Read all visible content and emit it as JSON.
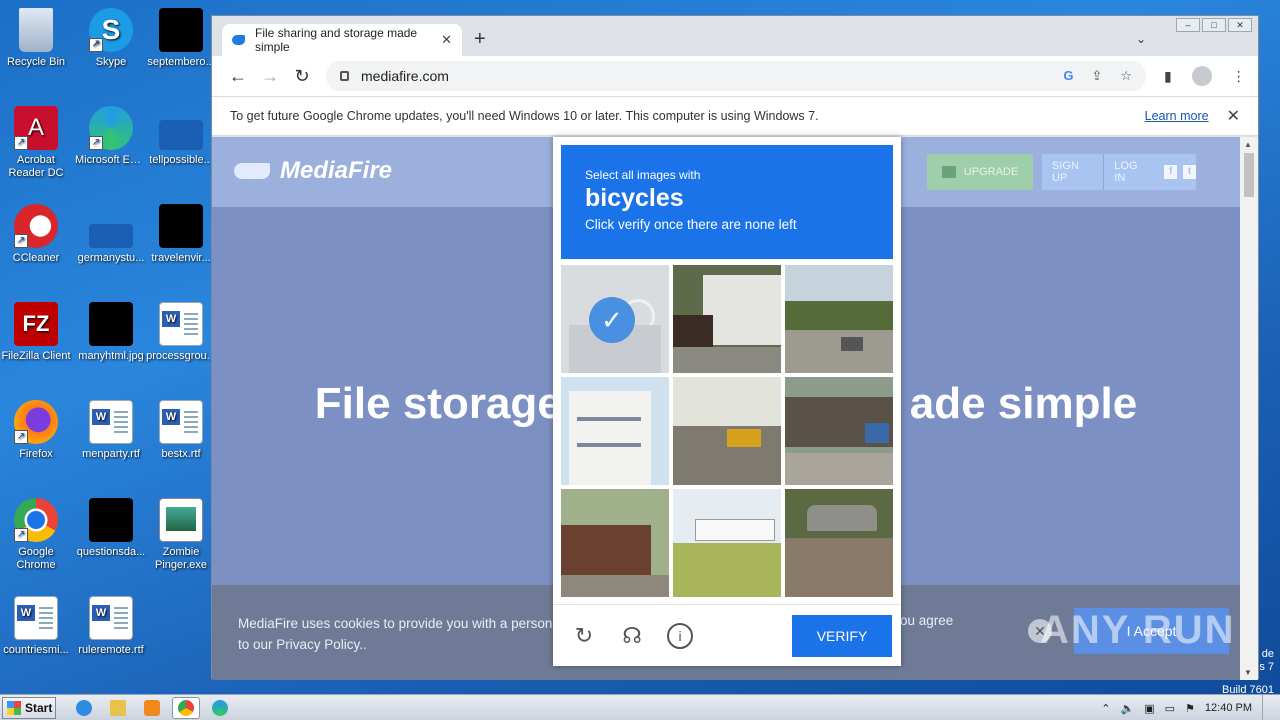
{
  "desktop": {
    "icons": [
      {
        "label": "Recycle Bin"
      },
      {
        "label": "Skype"
      },
      {
        "label": "septembero..."
      },
      {
        "label": "Acrobat Reader DC"
      },
      {
        "label": "Microsoft Edge"
      },
      {
        "label": "tellpossible..."
      },
      {
        "label": "CCleaner"
      },
      {
        "label": "germanystu..."
      },
      {
        "label": "travelenvir..."
      },
      {
        "label": "FileZilla Client"
      },
      {
        "label": "manyhtml.jpg"
      },
      {
        "label": "processgrou..."
      },
      {
        "label": "Firefox"
      },
      {
        "label": "menparty.rtf"
      },
      {
        "label": "bestx.rtf"
      },
      {
        "label": "Google Chrome"
      },
      {
        "label": "questionsda..."
      },
      {
        "label": "Zombie Pinger.exe"
      },
      {
        "label": "countriesmi..."
      },
      {
        "label": "ruleremote.rtf"
      }
    ],
    "windows_version": {
      "line1": "de",
      "line2": "s 7",
      "line3": "Build 7601"
    },
    "watermark": "ANY RUN"
  },
  "browser": {
    "tab_title": "File sharing and storage made simple",
    "url": "mediafire.com",
    "infobar_text": "To get future Google Chrome updates, you'll need Windows 10 or later. This computer is using Windows 7.",
    "infobar_link": "Learn more"
  },
  "mediafire": {
    "logo": "MediaFire",
    "upgrade": "UPGRADE",
    "signup": "SIGN UP",
    "login": "LOG IN",
    "hero_left": "File storage",
    "hero_right": "ade simple",
    "cookie_text": "MediaFire uses cookies to provide you with a personal",
    "cookie_text_line2": "to our Privacy Policy..",
    "cookie_text_right": "ou agree",
    "accept": "I Accept"
  },
  "captcha": {
    "instruction_line1": "Select all images with",
    "target": "bicycles",
    "instruction_line3": "Click verify once there are none left",
    "verify": "VERIFY",
    "tiles": [
      {
        "name": "bicycle-selected",
        "selected": true
      },
      {
        "name": "building-street",
        "selected": false
      },
      {
        "name": "road-trees",
        "selected": false
      },
      {
        "name": "white-house",
        "selected": false
      },
      {
        "name": "bus-road",
        "selected": false
      },
      {
        "name": "market-street",
        "selected": false
      },
      {
        "name": "shack",
        "selected": false
      },
      {
        "name": "white-bus-grass",
        "selected": false
      },
      {
        "name": "car-park",
        "selected": false
      }
    ]
  },
  "taskbar": {
    "start": "Start",
    "clock": "12:40 PM"
  }
}
